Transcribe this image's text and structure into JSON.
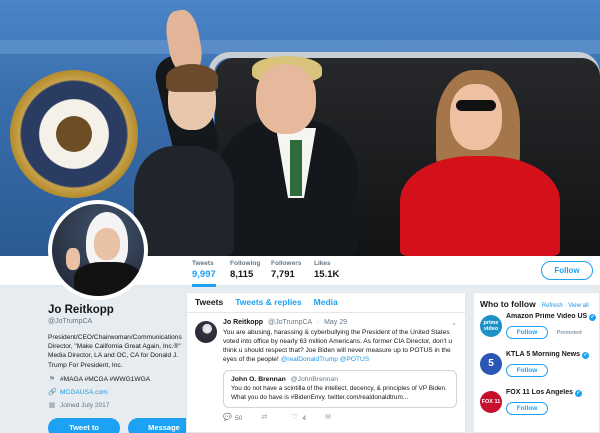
{
  "header": {
    "image_alt": "header photo"
  },
  "profile": {
    "name": "Jo Reitkopp",
    "handle": "@JoTrumpCA",
    "bio": "President/CEO/Chairwoman/Communications Director, \"Make California Great Again, Inc.®\" Media Director, LA and OC, CA for Donald J. Trump For President, Inc.",
    "hashtags": "#MAGA #MCGA #WWG1WGA",
    "website": "MCGAUSA.com",
    "joined": "Joined July 2017",
    "tweet_to_label": "Tweet to",
    "message_label": "Message"
  },
  "stats": [
    {
      "label": "Tweets",
      "value": "9,997"
    },
    {
      "label": "Following",
      "value": "8,115"
    },
    {
      "label": "Followers",
      "value": "7,791"
    },
    {
      "label": "Likes",
      "value": "15.1K"
    }
  ],
  "follow_label": "Follow",
  "tabs": [
    "Tweets",
    "Tweets & replies",
    "Media"
  ],
  "tweet": {
    "name": "Jo Reitkopp",
    "handle": "@JoTrumpCA",
    "date": "May 29",
    "text": "You are abusing, harassing & cyberbullying the President of the United States voted into office by nearly 63 million Americans. As former CIA Director, don't u think u should respect that? Joe Biden will never measure up to POTUS in the eyes of the people! ",
    "mentions": "@realDonaldTrump @POTUS",
    "quote": {
      "name": "John O. Brennan",
      "handle": "@JohnBrennan",
      "text": "You do not have a scintilla of the intellect, decency, & principles of VP Biden. What you do have is #BidenEnvy. twitter.com/realdonaldtrum..."
    },
    "replies": "50",
    "retweets": "",
    "likes": "4"
  },
  "who_to_follow": {
    "title": "Who to follow",
    "refresh": "· Refresh · View all",
    "items": [
      {
        "name": "Amazon Prime Video US",
        "handle": "",
        "logo_text": "prime video",
        "logo_color": "#1e90c8",
        "promoted": "Promoted"
      },
      {
        "name": "KTLA 5 Morning News",
        "handle": "",
        "logo_text": "5",
        "logo_color": "#2c56b5",
        "promoted": ""
      },
      {
        "name": "FOX 11 Los Angeles",
        "handle": "",
        "logo_text": "FOX 11",
        "logo_color": "#c8102e",
        "promoted": ""
      }
    ]
  },
  "colors": {
    "accent": "#1da1f2",
    "link": "#1b95e0",
    "muted": "#657786"
  }
}
